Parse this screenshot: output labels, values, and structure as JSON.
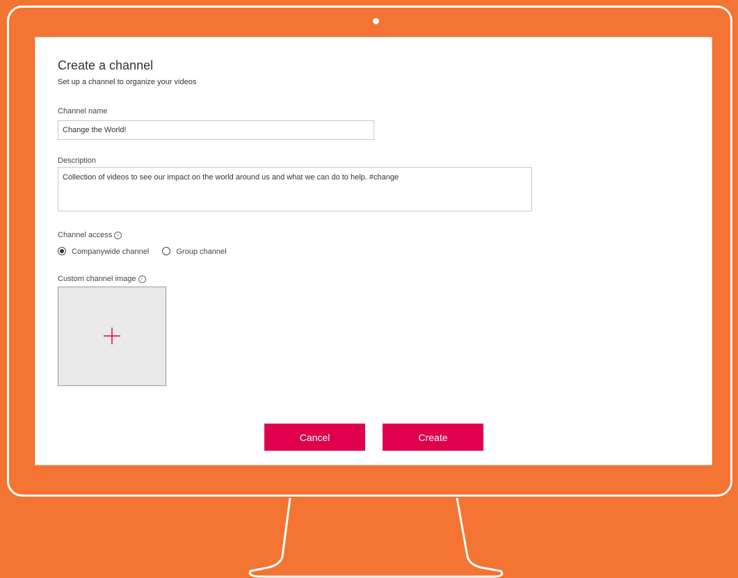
{
  "dialog": {
    "title": "Create a channel",
    "subtitle": "Set up a channel to organize your videos"
  },
  "channel_name": {
    "label": "Channel name",
    "value": "Change the World!"
  },
  "description": {
    "label": "Description",
    "value": "Collection of videos to see our impact on the world around us and what we can do to help. #change"
  },
  "channel_access": {
    "label": "Channel access",
    "options": [
      {
        "label": "Companywide channel",
        "selected": true
      },
      {
        "label": "Group channel",
        "selected": false
      }
    ]
  },
  "custom_image": {
    "label": "Custom channel image"
  },
  "buttons": {
    "cancel": "Cancel",
    "create": "Create"
  },
  "icons": {
    "info": "info-icon",
    "add": "plus-icon"
  },
  "colors": {
    "background": "#F47433",
    "accent": "#E0004D"
  }
}
